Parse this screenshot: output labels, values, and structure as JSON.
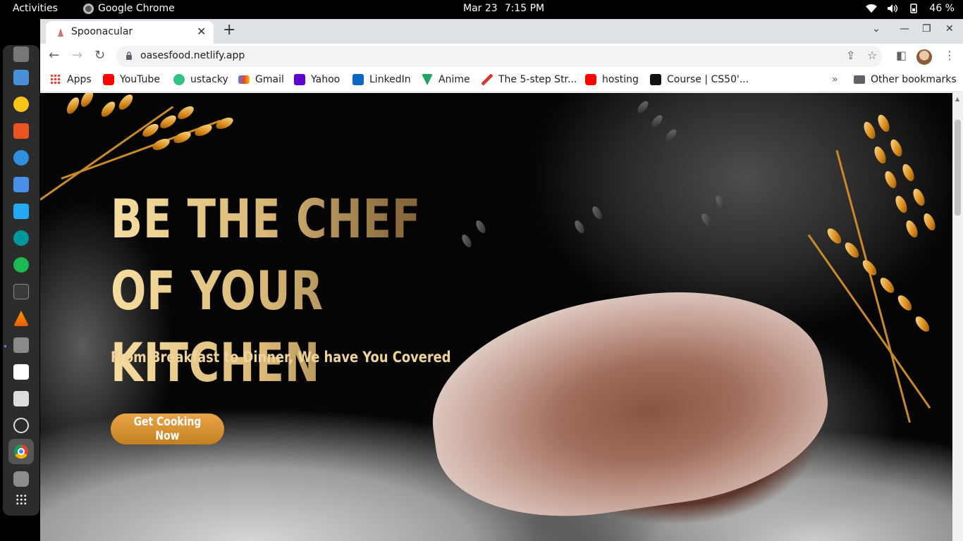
{
  "topbar": {
    "activities": "Activities",
    "app_name": "Google Chrome",
    "date": "Mar 23",
    "time": "7:15 PM",
    "battery": "46 %",
    "icons": [
      "wifi-icon",
      "volume-icon",
      "battery-icon"
    ]
  },
  "dock": {
    "apps": [
      "firefox-icon",
      "document-viewer-icon",
      "rhythmbox-icon",
      "software-center-icon",
      "help-icon",
      "text-editor-icon",
      "vscode-icon",
      "arduino-icon",
      "spotify-icon",
      "terminal-icon",
      "vlc-icon",
      "files-icon",
      "notion-icon",
      "document-scanner-icon",
      "search-icon",
      "chrome-icon",
      "drive-icon",
      "show-apps-icon"
    ]
  },
  "browser": {
    "tab_title": "Spoonacular",
    "url": "oasesfood.netlify.app",
    "bookmarks": [
      {
        "label": "Apps",
        "icon": "apps-grid-icon"
      },
      {
        "label": "YouTube",
        "icon": "youtube-icon"
      },
      {
        "label": "ustacky",
        "icon": "ustacky-icon"
      },
      {
        "label": "Gmail",
        "icon": "gmail-icon"
      },
      {
        "label": "Yahoo",
        "icon": "yahoo-icon"
      },
      {
        "label": "LinkedIn",
        "icon": "linkedin-icon"
      },
      {
        "label": "Anime",
        "icon": "anime-icon"
      },
      {
        "label": "The 5-step Str...",
        "icon": "link-icon"
      },
      {
        "label": "hosting",
        "icon": "youtube-icon"
      },
      {
        "label": "Course | CS50'...",
        "icon": "edx-icon"
      }
    ],
    "overflow": "»",
    "other_bookmarks": "Other bookmarks"
  },
  "hero": {
    "title": "BE THE CHEF OF YOUR KITCHEN",
    "subtitle": "From Breakfast to Dinner, We have You Covered",
    "cta": "Get Cooking Now"
  },
  "colors": {
    "accent": "#d69a3a",
    "title_gold": "#e6c98a",
    "chrome_tabstrip": "#dee1e6"
  }
}
